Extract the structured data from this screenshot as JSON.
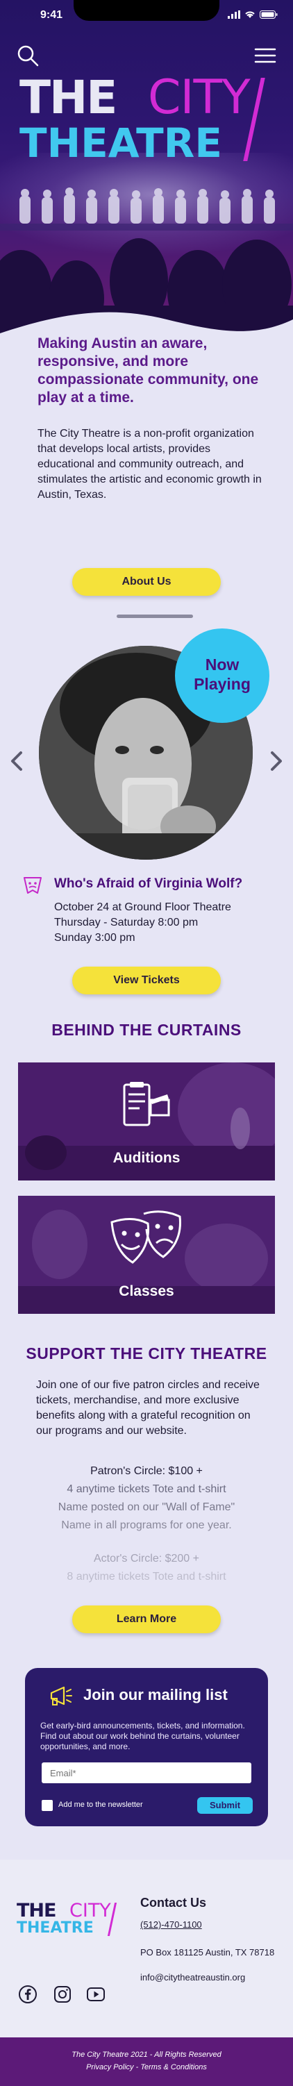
{
  "status_bar": {
    "time": "9:41"
  },
  "hero": {
    "logo": {
      "line1_a": "THE",
      "line1_b": "CITY",
      "line2": "THEATRE"
    }
  },
  "mission": {
    "heading": "Making Austin an aware, responsive, and more compassionate community, one play at a time.",
    "text": "The City Theatre is a non-profit organization that develops local artists, provides educational and community outreach, and stimulates the artistic and economic growth in Austin, Texas.",
    "about_label": "About Us"
  },
  "now_playing": {
    "badge_line1": "Now",
    "badge_line2": "Playing",
    "show_title": "Who's Afraid of Virginia Wolf?",
    "details": [
      "October 24 at Ground Floor Theatre",
      "Thursday - Saturday 8:00 pm",
      "Sunday 3:00 pm"
    ],
    "tickets_label": "View Tickets"
  },
  "curtains": {
    "title": "BEHIND THE CURTAINS",
    "cards": [
      {
        "label": "Auditions",
        "icon": "clipboard-clapper-icon"
      },
      {
        "label": "Classes",
        "icon": "theatre-masks-icon"
      }
    ]
  },
  "support": {
    "title": "SUPPORT THE CITY THEATRE",
    "text": "Join one of our five patron circles and receive tickets, merchandise, and more exclusive benefits along with a grateful recognition on our programs and our website.",
    "circles": [
      {
        "name": "Patron's Circle: $100 +",
        "benefits": [
          "4 anytime tickets Tote and t-shirt",
          "Name posted on our \"Wall of Fame\"",
          "Name in all programs for one year."
        ]
      },
      {
        "name": "Actor's Circle: $200 +",
        "benefits": [
          "8 anytime tickets Tote and t-shirt"
        ]
      }
    ],
    "more_label": "Learn More"
  },
  "mailing": {
    "title": "Join our mailing list",
    "text": "Get early-bird announcements, tickets, and information. Find out about our work behind the curtains, volunteer opportunities, and more.",
    "email_placeholder": "Email*",
    "checkbox_label": "Add me to the newsletter",
    "submit_label": "Submit"
  },
  "footer": {
    "contact_title": "Contact Us",
    "phone": "(512)-470-1100",
    "address": "PO Box 181125 Austin, TX 78718",
    "email": "info@citytheatreaustin.org",
    "copyright": "The City Theatre 2021 - All Rights Reserved",
    "links": "Privacy Policy - Terms & Conditions",
    "social": [
      "facebook-icon",
      "instagram-icon",
      "youtube-icon"
    ]
  },
  "colors": {
    "purple": "#4b0f7a",
    "magenta": "#d22bd4",
    "cyan": "#34c5f0",
    "yellow": "#f5e23a",
    "background": "#e6e5f5"
  }
}
